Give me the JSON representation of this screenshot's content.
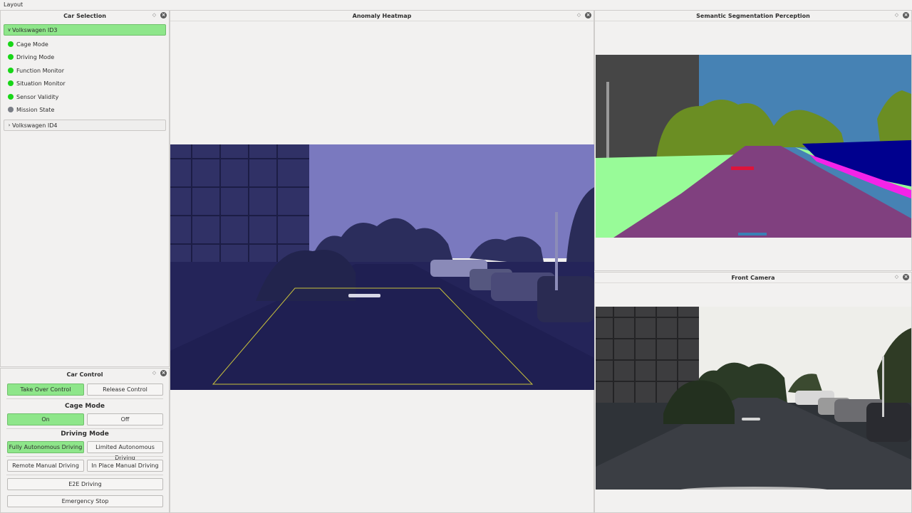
{
  "menu": {
    "layout_label": "Layout"
  },
  "car_selection": {
    "title": "Car Selection",
    "vehicles": [
      {
        "name": "Volkswagen ID3",
        "expanded": true
      },
      {
        "name": "Volkswagen ID4",
        "expanded": false
      }
    ],
    "statuses": [
      {
        "label": "Cage Mode",
        "color": "#17d617"
      },
      {
        "label": "Driving Mode",
        "color": "#17d617"
      },
      {
        "label": "Function Monitor",
        "color": "#17d617"
      },
      {
        "label": "Situation Monitor",
        "color": "#17d617"
      },
      {
        "label": "Sensor Validity",
        "color": "#17d617"
      },
      {
        "label": "Mission State",
        "color": "#7a7e86"
      }
    ]
  },
  "car_control": {
    "title": "Car Control",
    "take_over": "Take Over Control",
    "release": "Release Control",
    "cage_mode_heading": "Cage Mode",
    "cage_on": "On",
    "cage_off": "Off",
    "driving_mode_heading": "Driving Mode",
    "fully_autonomous": "Fully Autonomous Driving",
    "limited_autonomous": "Limited Autonomous Driving",
    "remote_manual": "Remote Manual Driving",
    "in_place_manual": "In Place Manual Driving",
    "e2e": "E2E Driving",
    "emergency": "Emergency Stop"
  },
  "anomaly_heatmap": {
    "title": "Anomaly Heatmap"
  },
  "segmentation": {
    "title": "Semantic Segmentation Perception"
  },
  "front_camera": {
    "title": "Front Camera"
  },
  "colors": {
    "active_green": "#8ee68a",
    "status_green": "#17d617",
    "heatmap_tint": "#2c2c86",
    "seg_sky": "#4682b4",
    "seg_road": "#80407f",
    "seg_vegetation": "#6b8e23",
    "seg_sidewalk": "#98fb98",
    "seg_car": "#00008e"
  }
}
